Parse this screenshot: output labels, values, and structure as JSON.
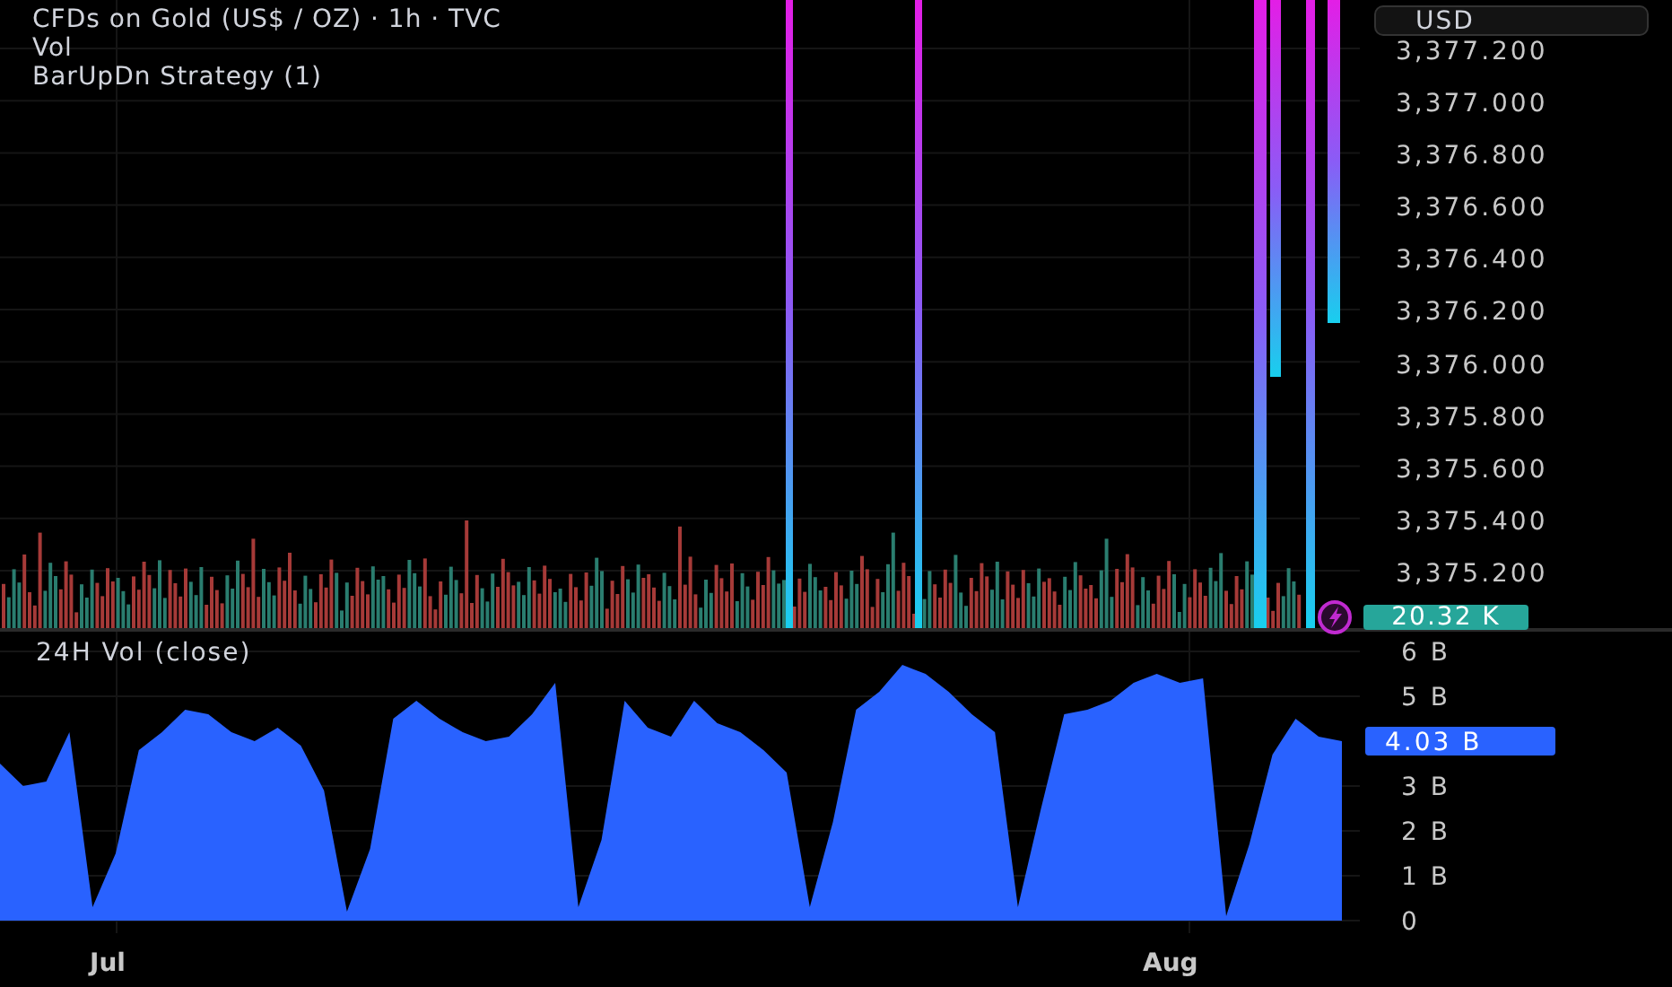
{
  "legend": {
    "symbol": "CFDs on Gold (US$ / OZ) · 1h · TVC",
    "lines": [
      "Vol",
      "BarUpDn Strategy (1)"
    ]
  },
  "currency_button": "USD",
  "price_scale": [
    "3,377.200",
    "3,377.000",
    "3,376.800",
    "3,376.600",
    "3,376.400",
    "3,376.200",
    "3,376.000",
    "3,375.800",
    "3,375.600",
    "3,375.400",
    "3,375.200"
  ],
  "volume_badge": {
    "text": "20.32 K",
    "color": "#26a69a"
  },
  "time_axis": [
    "Jul",
    "Aug"
  ],
  "vol_pane": {
    "title": "24H Vol (close)",
    "last_value": "4.03 B",
    "chart_data": {
      "type": "area",
      "ylim": [
        0,
        6
      ],
      "yticks": [
        {
          "value": 0,
          "label": "0"
        },
        {
          "value": 1,
          "label": "1 B"
        },
        {
          "value": 2,
          "label": "2 B"
        },
        {
          "value": 3,
          "label": "3 B"
        },
        {
          "value": 5,
          "label": "5 B"
        },
        {
          "value": 6,
          "label": "6 B"
        }
      ],
      "grid": true,
      "series": [
        {
          "color": "#2962ff",
          "values": [
            3.5,
            3.0,
            3.1,
            4.2,
            0.3,
            1.5,
            3.8,
            4.2,
            4.7,
            4.6,
            4.2,
            4.0,
            4.3,
            3.9,
            2.9,
            0.2,
            1.6,
            4.5,
            4.9,
            4.5,
            4.2,
            4.0,
            4.1,
            4.6,
            5.3,
            0.3,
            1.8,
            4.9,
            4.3,
            4.1,
            4.9,
            4.4,
            4.2,
            3.8,
            3.3,
            0.3,
            2.2,
            4.7,
            5.1,
            5.7,
            5.5,
            5.1,
            4.6,
            4.2,
            0.3,
            2.5,
            4.6,
            4.7,
            4.9,
            5.3,
            5.5,
            5.3,
            5.4,
            0.1,
            1.7,
            3.7,
            4.5,
            4.1,
            4.0
          ]
        }
      ]
    }
  }
}
